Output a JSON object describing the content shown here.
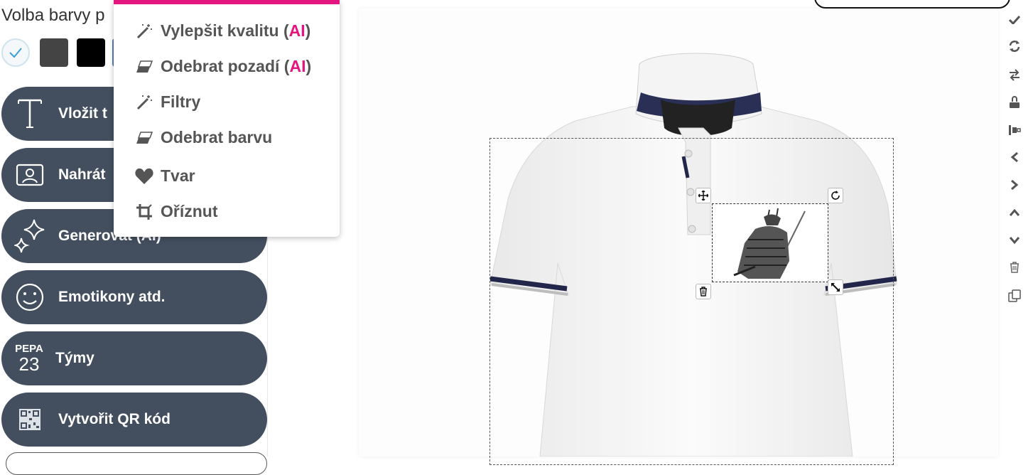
{
  "left_panel": {
    "color_title": "Volba barvy p",
    "swatches": [
      "#f4f8fb",
      "#444444",
      "#000000"
    ],
    "buttons": [
      {
        "label": "Vložit t",
        "icon": "text-icon"
      },
      {
        "label": "Nahrát",
        "icon": "upload-image-icon"
      },
      {
        "label": "Generovat (AI)",
        "icon": "sparkle-icon"
      },
      {
        "label": "Emotikony atd.",
        "icon": "smiley-icon"
      },
      {
        "label": "Týmy",
        "icon": "team-number-icon",
        "icon_text_top": "PEPA",
        "icon_text_bottom": "23"
      },
      {
        "label": "Vytvořit QR kód",
        "icon": "qr-code-icon"
      }
    ]
  },
  "menu": {
    "items": [
      {
        "text": "Vylepšit kvalitu (",
        "ai": "AI",
        "close": ")",
        "icon": "magic-wand-icon"
      },
      {
        "text": "Odebrat pozadí (",
        "ai": "AI",
        "close": ")",
        "icon": "eraser-icon"
      },
      {
        "text": "Filtry",
        "icon": "magic-wand-icon"
      },
      {
        "text": "Odebrat barvu",
        "icon": "eraser-icon"
      },
      {
        "text": "Tvar",
        "icon": "heart-icon"
      },
      {
        "text": "Oříznut",
        "icon": "crop-icon"
      }
    ]
  },
  "colors": {
    "button_bg": "#434f5e",
    "accent": "#e4157e",
    "menu_text": "#555555"
  },
  "right_toolbar": [
    "check-icon",
    "refresh-icon",
    "swap-icon",
    "lock-icon",
    "align-icon",
    "chevron-left-icon",
    "chevron-right-icon",
    "chevron-up-icon",
    "chevron-down-icon",
    "trash-icon",
    "duplicate-icon"
  ]
}
